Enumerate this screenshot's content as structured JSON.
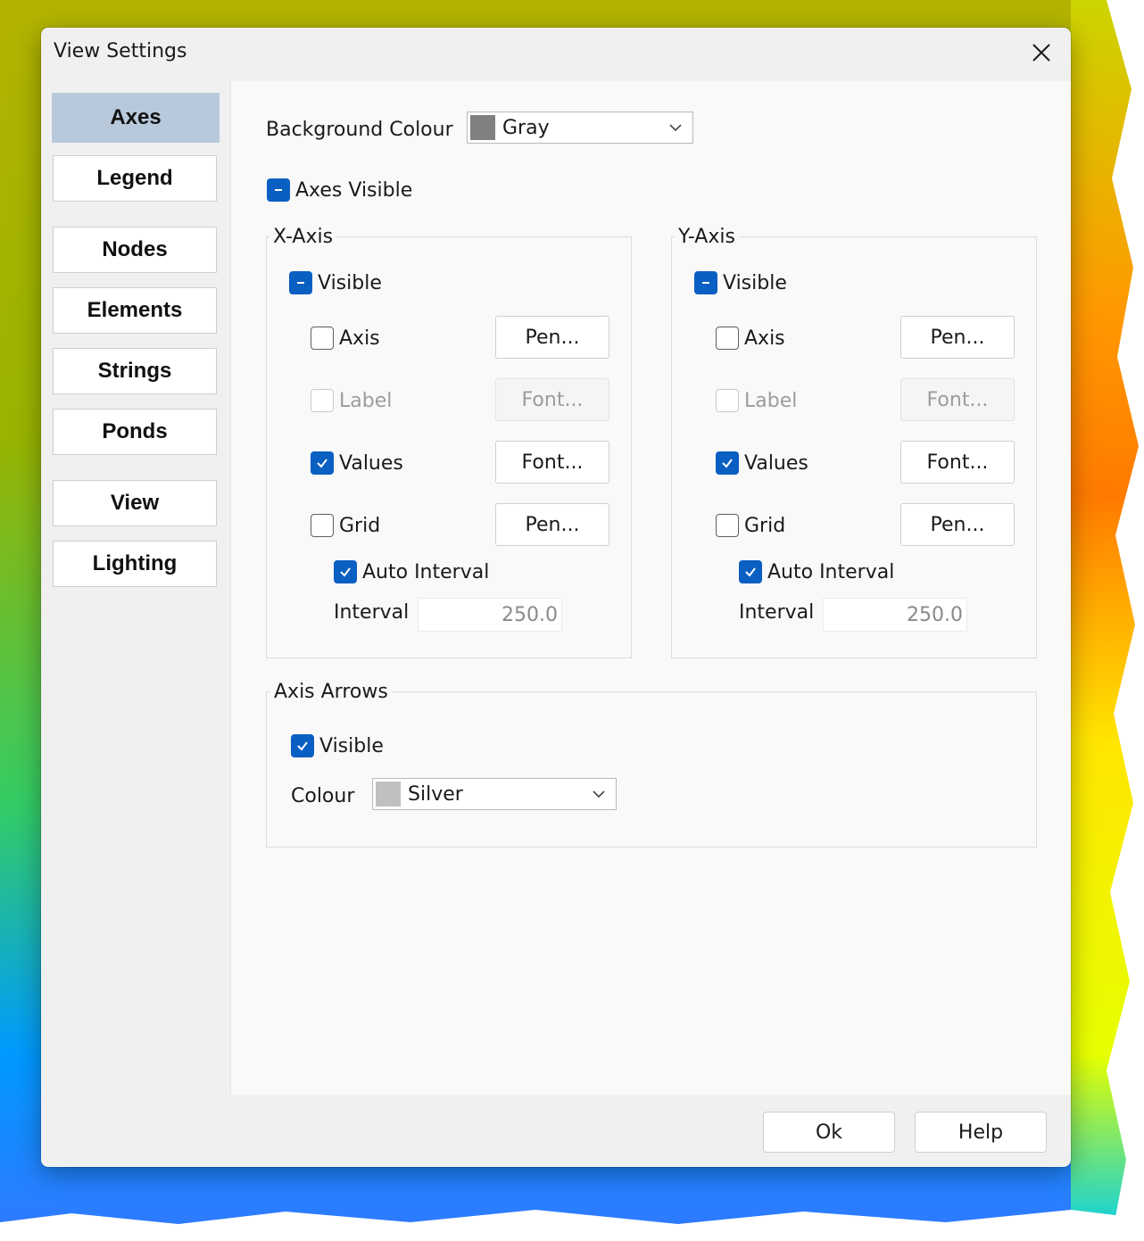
{
  "dialog": {
    "title": "View Settings",
    "ok_label": "Ok",
    "help_label": "Help"
  },
  "sidebar": {
    "items": [
      {
        "label": "Axes",
        "active": true
      },
      {
        "label": "Legend"
      },
      {
        "label": "Nodes"
      },
      {
        "label": "Elements"
      },
      {
        "label": "Strings"
      },
      {
        "label": "Ponds"
      },
      {
        "label": "View"
      },
      {
        "label": "Lighting"
      }
    ]
  },
  "axes": {
    "background_colour_label": "Background Colour",
    "background_colour": {
      "value": "Gray",
      "swatch": "#808080"
    },
    "axes_visible_label": "Axes Visible",
    "x_axis": {
      "title": "X-Axis",
      "visible_label": "Visible",
      "axis_label": "Axis",
      "label_label": "Label",
      "values_label": "Values",
      "grid_label": "Grid",
      "auto_interval_label": "Auto Interval",
      "interval_label": "Interval",
      "interval_value": "250.0",
      "pen_label": "Pen...",
      "font_label": "Font..."
    },
    "y_axis": {
      "title": "Y-Axis",
      "visible_label": "Visible",
      "axis_label": "Axis",
      "label_label": "Label",
      "values_label": "Values",
      "grid_label": "Grid",
      "auto_interval_label": "Auto Interval",
      "interval_label": "Interval",
      "interval_value": "250.0",
      "pen_label": "Pen...",
      "font_label": "Font..."
    },
    "axis_arrows": {
      "title": "Axis Arrows",
      "visible_label": "Visible",
      "colour_label": "Colour",
      "colour": {
        "value": "Silver",
        "swatch": "#c0c0c0"
      }
    }
  },
  "colors": {
    "accent": "#0a5fc2",
    "nav_active": "#b9c9dc"
  }
}
